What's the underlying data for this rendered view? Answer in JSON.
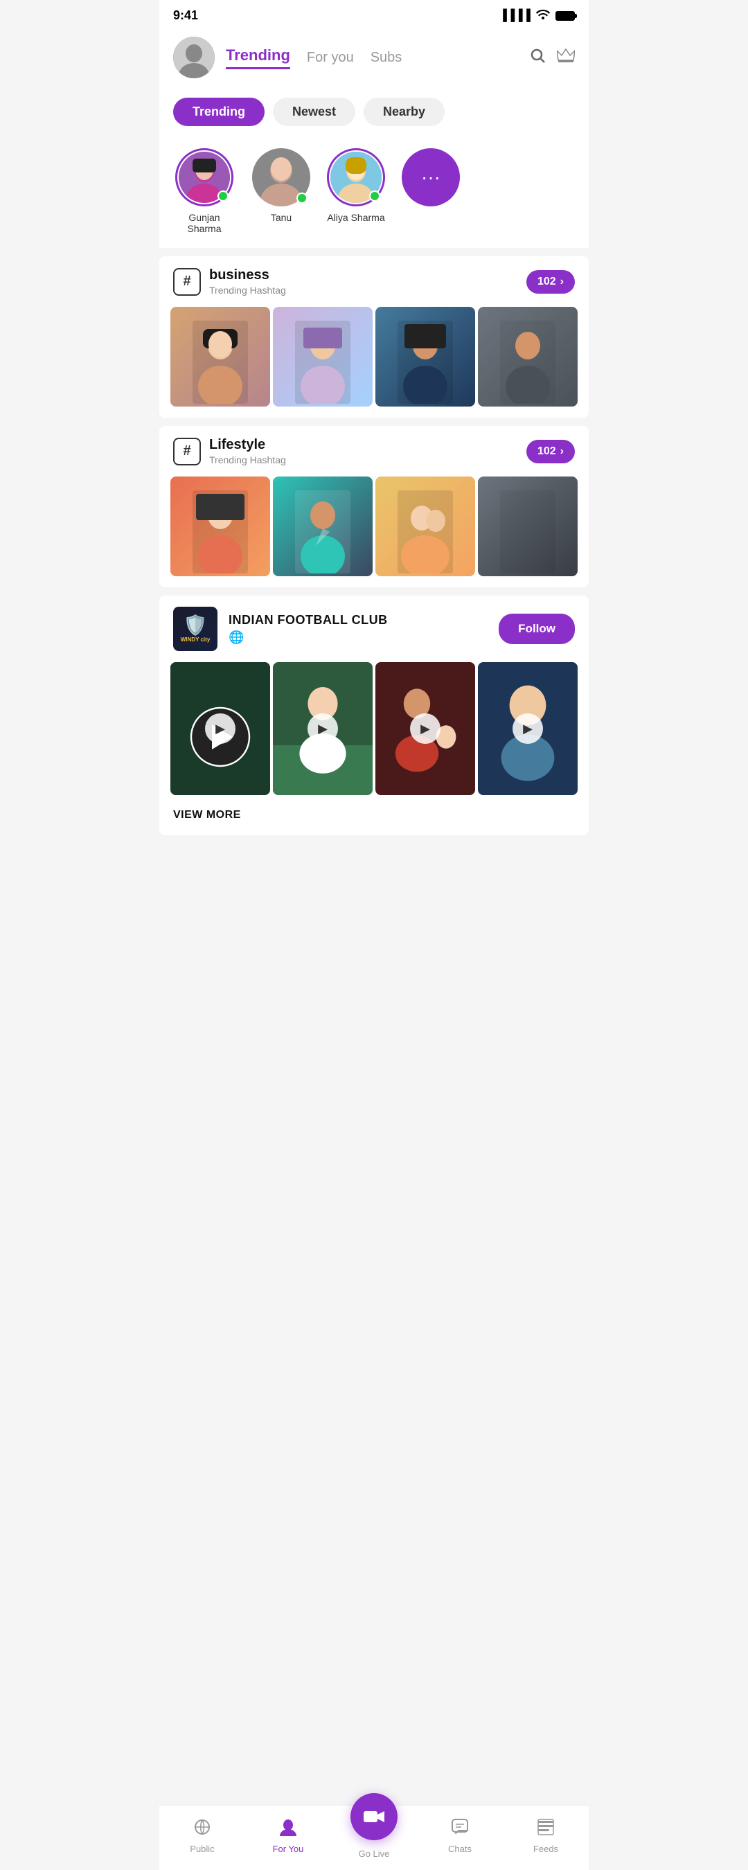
{
  "statusBar": {
    "time": "9:41"
  },
  "header": {
    "avatarEmoji": "👩",
    "navItems": [
      {
        "label": "Trending",
        "active": true
      },
      {
        "label": "For you",
        "active": false
      },
      {
        "label": "Subs",
        "active": false
      }
    ],
    "searchIcon": "🔍",
    "crownIcon": "👑"
  },
  "filterTabs": [
    {
      "label": "Trending",
      "active": true
    },
    {
      "label": "Newest",
      "active": false
    },
    {
      "label": "Nearby",
      "active": false
    }
  ],
  "stories": [
    {
      "name": "Gunjan Sharma",
      "online": true,
      "hasRing": true,
      "emoji": "👩"
    },
    {
      "name": "Tanu",
      "online": true,
      "hasRing": false,
      "emoji": "👩‍🦱"
    },
    {
      "name": "Aliya Sharma",
      "online": true,
      "hasRing": true,
      "emoji": "👱‍♀️"
    },
    {
      "name": "More",
      "isMore": true
    }
  ],
  "trendingHashtags": [
    {
      "tag": "business",
      "subtitle": "Trending Hashtag",
      "count": 102,
      "images": [
        "img-person-1",
        "img-person-2",
        "img-person-3",
        "img-person-4"
      ]
    },
    {
      "tag": "Lifestyle",
      "subtitle": "Trending Hashtag",
      "count": 102,
      "images": [
        "img-lifestyle-1",
        "img-lifestyle-2",
        "img-lifestyle-3",
        "img-lifestyle-4"
      ]
    }
  ],
  "club": {
    "logoText": "WINDY city",
    "name": "INDIAN FOOTBALL CLUB",
    "globeIcon": "🌐",
    "followLabel": "Follow",
    "videos": [
      "img-football-1",
      "img-football-2",
      "img-football-3",
      "img-football-4"
    ],
    "viewMoreLabel": "VIEW MORE"
  },
  "bottomNav": [
    {
      "icon": "((·))",
      "label": "Public",
      "active": false
    },
    {
      "icon": "👤",
      "label": "For You",
      "active": true
    },
    {
      "icon": "🎥",
      "label": "Go Live",
      "isCenter": true
    },
    {
      "icon": "💬",
      "label": "Chats",
      "active": false
    },
    {
      "icon": "☰",
      "label": "Feeds",
      "active": false
    }
  ]
}
